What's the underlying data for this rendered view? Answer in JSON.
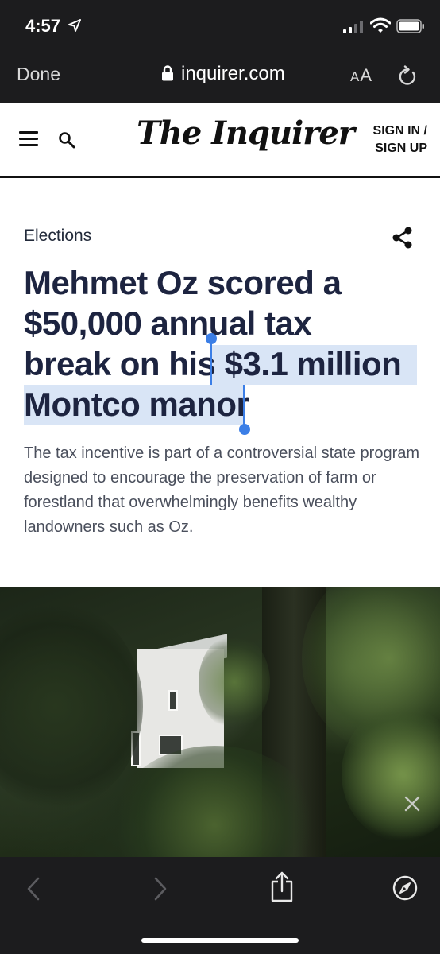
{
  "status_bar": {
    "time": "4:57"
  },
  "safari": {
    "done_label": "Done",
    "url": "inquirer.com",
    "text_size_label_small": "A",
    "text_size_label_large": "A"
  },
  "site": {
    "logo": "The Inquirer",
    "sign_in_line1": "SIGN IN /",
    "sign_in_line2": "SIGN UP"
  },
  "article": {
    "section": "Elections",
    "headline_line1": "Mehmet Oz scored a",
    "headline_line2": "$50,000 annual tax",
    "headline_line3_plain": "break on his ",
    "headline_line3_selected": "$3.1 million",
    "headline_line4_selected": "Montco manor",
    "dek": "The tax incentive is part of a controversial state program designed to encourage the preservation of farm or forestland that overwhelmingly benefits wealthy landowners such as Oz."
  },
  "colors": {
    "chrome": "#1c1c1e",
    "headline": "#1d2440",
    "selection": "#d9e5f6",
    "selection_handle": "#3b7ee6"
  }
}
